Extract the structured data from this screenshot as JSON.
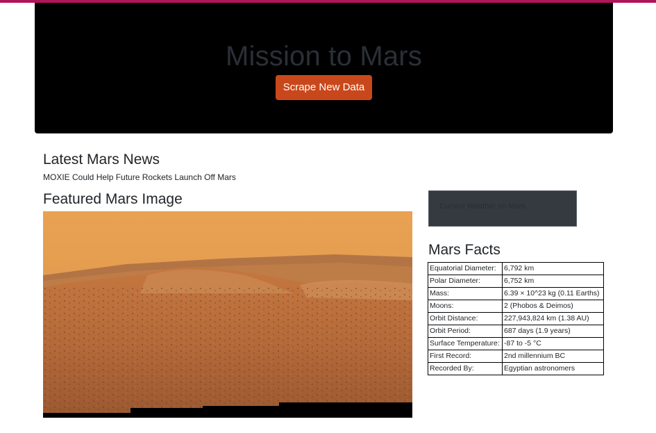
{
  "header": {
    "title": "Mission to Mars",
    "scrape_button": "Scrape New Data"
  },
  "news": {
    "heading": "Latest Mars News",
    "title": "MOXIE Could Help Future Rockets Launch Off Mars"
  },
  "featured_image": {
    "heading": "Featured Mars Image"
  },
  "weather": {
    "label": "Current Weather on Mars"
  },
  "facts": {
    "heading": "Mars Facts",
    "rows": [
      {
        "key": "Equatorial Diameter:",
        "value": "6,792 km"
      },
      {
        "key": "Polar Diameter:",
        "value": "6,752 km"
      },
      {
        "key": "Mass:",
        "value": "6.39 × 10^23 kg (0.11 Earths)"
      },
      {
        "key": "Moons:",
        "value": "2 (Phobos & Deimos)"
      },
      {
        "key": "Orbit Distance:",
        "value": "227,943,824 km (1.38 AU)"
      },
      {
        "key": "Orbit Period:",
        "value": "687 days (1.9 years)"
      },
      {
        "key": "Surface Temperature:",
        "value": "-87 to -5 °C"
      },
      {
        "key": "First Record:",
        "value": "2nd millennium BC"
      },
      {
        "key": "Recorded By:",
        "value": "Egyptian astronomers"
      }
    ]
  },
  "colors": {
    "top_bar": "#b0155a",
    "jumbotron_bg": "#000000",
    "button_bg": "#c9481b",
    "weather_bg": "#343a40"
  }
}
